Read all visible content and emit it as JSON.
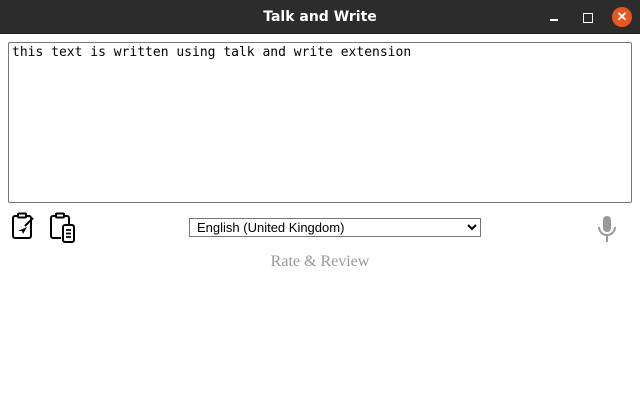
{
  "window": {
    "title": "Talk and Write",
    "close_glyph": "✕"
  },
  "editor": {
    "text": "this text is written using talk and write extension"
  },
  "language": {
    "selected": "English (United Kingdom)"
  },
  "footer": {
    "rate_label": "Rate & Review"
  },
  "colors": {
    "titlebar": "#2c2c2c",
    "close": "#e95420",
    "mic": "#999999"
  }
}
